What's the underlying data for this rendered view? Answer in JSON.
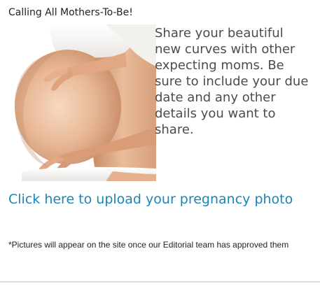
{
  "widget": {
    "title": "Calling All Mothers-To-Be!",
    "image": "pregnant-belly-photo",
    "description": "Share your beautiful new curves with other expecting moms. Be sure to include your due date and any other details you want to share.",
    "upload_link": "Click here to upload your pregnancy photo",
    "footnote": "*Pictures will appear on the site once our Editorial team has approved them"
  },
  "colors": {
    "link": "#1a86b8",
    "body_text": "#4c4c4c",
    "title_text": "#222222",
    "divider": "#dcdcdc"
  }
}
